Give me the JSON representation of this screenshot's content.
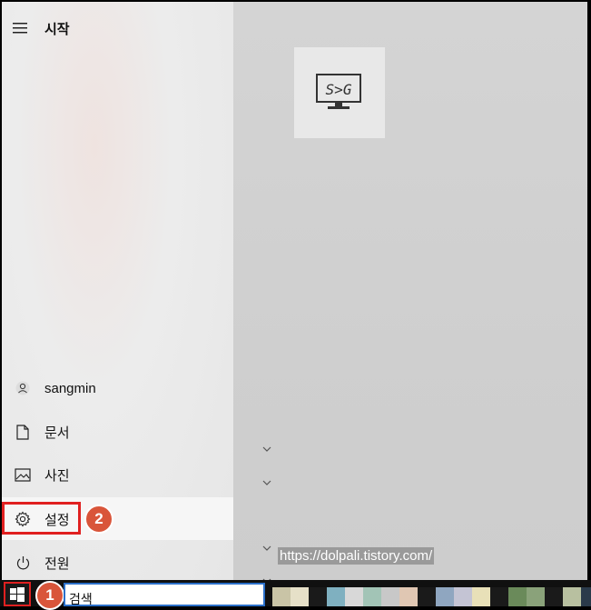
{
  "start_menu": {
    "title": "시작",
    "user": "sangmin",
    "documents": "문서",
    "pictures": "사진",
    "settings": "설정",
    "power": "전원"
  },
  "tile": {
    "logo_text": "S>G"
  },
  "watermark": {
    "url": "https://dolpali.tistory.com/"
  },
  "taskbar": {
    "search_text": "검색"
  },
  "annotations": {
    "badge1": "1",
    "badge2": "2"
  },
  "colors": {
    "highlight_red": "#e02020",
    "badge": "#d9553a",
    "search_border": "#2a6fc9"
  }
}
